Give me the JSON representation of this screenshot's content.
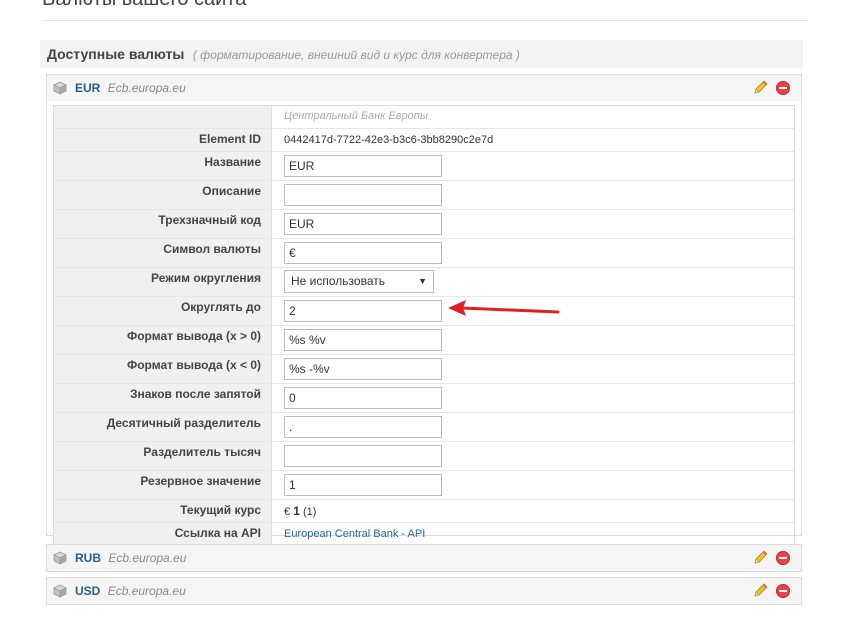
{
  "page": {
    "title": "Валюты вашего сайта",
    "section_title": "Доступные валюты",
    "section_subtitle": "( форматирование, внешний вид и курс для конвертера )"
  },
  "currencies": [
    {
      "code": "EUR",
      "source": "Ecb.europa.eu"
    },
    {
      "code": "RUB",
      "source": "Ecb.europa.eu"
    },
    {
      "code": "USD",
      "source": "Ecb.europa.eu"
    }
  ],
  "details": {
    "provider": "Центральный Банк Европы",
    "element_id_label": "Element ID",
    "element_id": "0442417d-7722-42e3-b3c6-3bb8290c2e7d",
    "name_label": "Название",
    "name_value": "EUR",
    "description_label": "Описание",
    "description_value": "",
    "code_label": "Трехзначный код",
    "code_value": "EUR",
    "symbol_label": "Символ валюты",
    "symbol_value": "€",
    "rounding_mode_label": "Режим округления",
    "rounding_mode_value": "Не использовать",
    "round_to_label": "Округлять до",
    "round_to_value": "2",
    "format_pos_label": "Формат вывода (x > 0)",
    "format_pos_value": "%s %v",
    "format_neg_label": "Формат вывода (x < 0)",
    "format_neg_value": "%s -%v",
    "decimals_label": "Знаков после запятой",
    "decimals_value": "0",
    "decimal_sep_label": "Десятичный разделитель",
    "decimal_sep_value": ".",
    "thousand_sep_label": "Разделитель тысяч",
    "thousand_sep_value": "",
    "fallback_label": "Резервное значение",
    "fallback_value": "1",
    "current_rate_label": "Текущий курс",
    "current_rate_symbol": "€",
    "current_rate_value": "1",
    "current_rate_raw": "(1)",
    "api_link_label": "Ссылка на API",
    "api_link_text": "European Central Bank - API"
  },
  "colors": {
    "link": "#2a5d8f",
    "delete": "#e84545",
    "arrow": "#e02020"
  }
}
